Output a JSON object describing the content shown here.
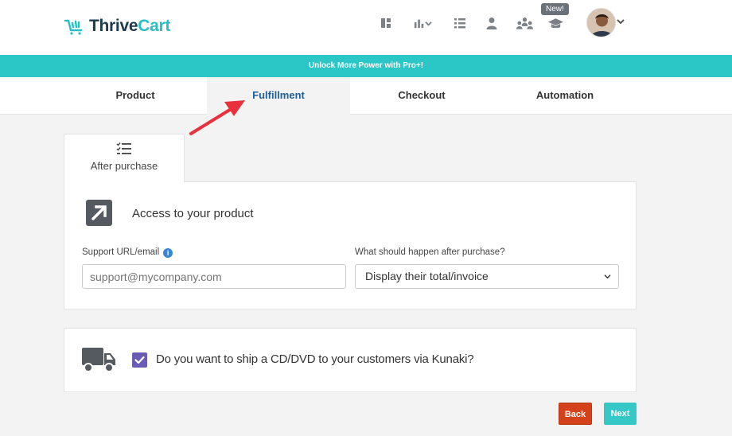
{
  "header": {
    "logo_text_dark": "Thrive",
    "logo_text_accent": "Cart",
    "new_badge": "New!",
    "nav_icons": [
      "dashboard-icon",
      "analytics-icon",
      "list-icon",
      "user-icon",
      "affiliates-icon",
      "academy-icon"
    ]
  },
  "banner": {
    "text": "Unlock More Power with Pro+!"
  },
  "tabs": [
    {
      "label": "Product"
    },
    {
      "label": "Fulfillment"
    },
    {
      "label": "Checkout"
    },
    {
      "label": "Automation"
    }
  ],
  "active_tab": "Fulfillment",
  "subtab": {
    "label": "After purchase",
    "icon": "checklist-icon"
  },
  "access_card": {
    "title": "Access to your product",
    "support_label": "Support URL/email",
    "support_placeholder": "support@mycompany.com",
    "support_value": "",
    "after_purchase_label": "What should happen after purchase?",
    "after_purchase_value": "Display their total/invoice"
  },
  "ship_card": {
    "label": "Do you want to ship a CD/DVD to your customers via Kunaki?",
    "checked": true
  },
  "buttons": {
    "back": "Back",
    "next": "Next"
  },
  "colors": {
    "teal": "#2bc6c6",
    "navy": "#1d3b4b",
    "active_tab": "#1f5e9a",
    "back": "#d4421c",
    "checkbox": "#6a5bb4",
    "arrow": "#e8313c"
  }
}
